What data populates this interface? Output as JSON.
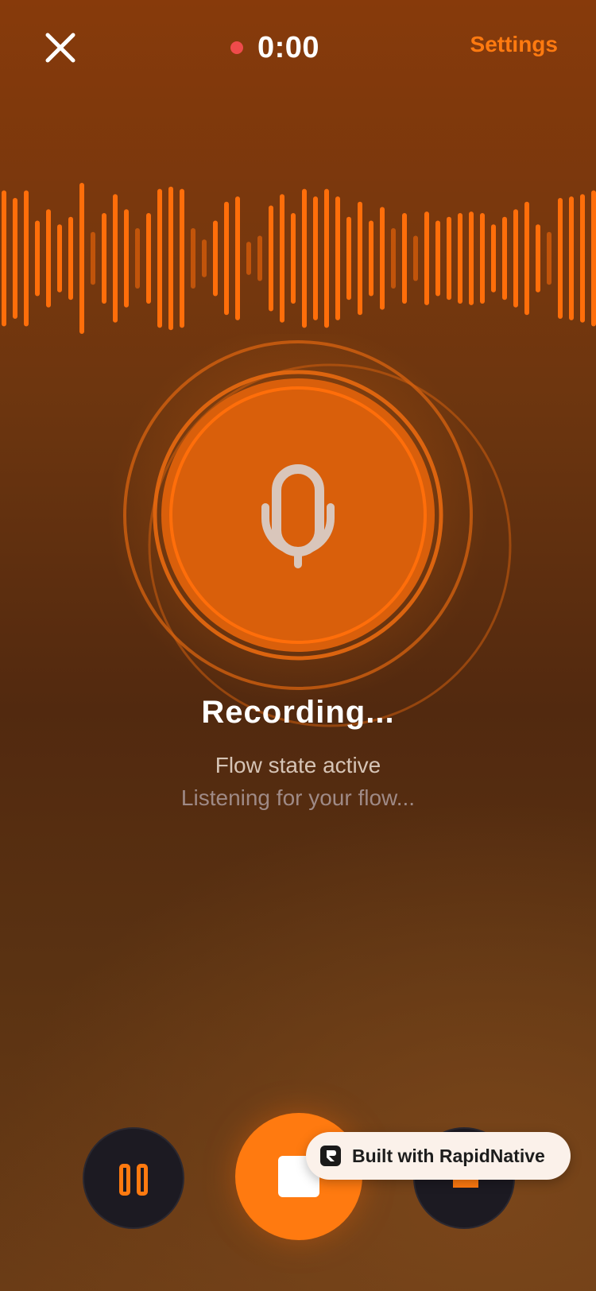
{
  "colors": {
    "accent": "#ff7a10",
    "record_dot": "#ef4b4b",
    "wave_bar": "#ff6e0a",
    "mic_fill": "#d95f0b",
    "mic_icon": "#d9c6bb"
  },
  "header": {
    "close_icon": "close-icon",
    "timer": "0:00",
    "settings_label": "Settings"
  },
  "waveform": {
    "levels": [
      0.9,
      0.8,
      0.9,
      0.5,
      0.65,
      0.45,
      0.55,
      1.0,
      0.35,
      0.6,
      0.85,
      0.65,
      0.4,
      0.6,
      0.92,
      0.95,
      0.92,
      0.4,
      0.25,
      0.5,
      0.75,
      0.82,
      0.22,
      0.3,
      0.7,
      0.85,
      0.6,
      0.92,
      0.82,
      0.92,
      0.82,
      0.55,
      0.75,
      0.5,
      0.68,
      0.4,
      0.6,
      0.3,
      0.62,
      0.5,
      0.55,
      0.6,
      0.62,
      0.6,
      0.45,
      0.55,
      0.65,
      0.75,
      0.45,
      0.35,
      0.8,
      0.82,
      0.85,
      0.9,
      0.92,
      0.95,
      0.4
    ]
  },
  "mic": {
    "icon": "microphone-icon"
  },
  "status": {
    "title": "Recording...",
    "subtitle": "Flow state active",
    "hint": "Listening for your flow..."
  },
  "controls": {
    "pause_icon": "pause-icon",
    "stop_icon": "stop-icon",
    "third_icon": "minus-icon"
  },
  "badge": {
    "text": "Built with RapidNative",
    "logo": "rapidnative-logo"
  }
}
